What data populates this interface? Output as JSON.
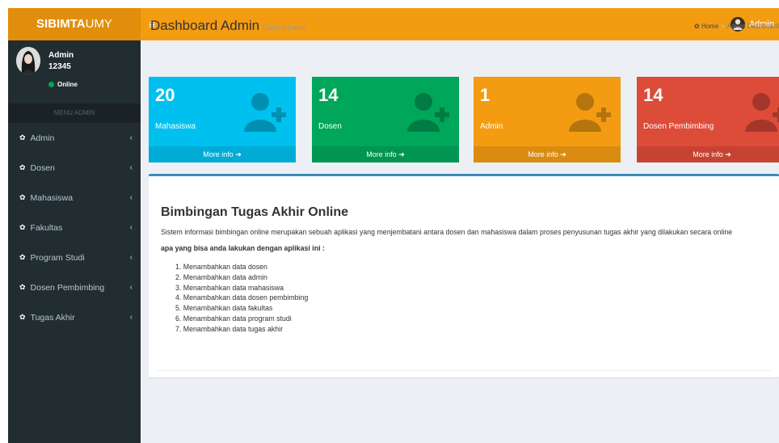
{
  "header": {
    "logo_bold": "SIBIMTA",
    "logo_light": "UMY",
    "menu_toggle": "≡",
    "user_label": "Admin"
  },
  "sidebar": {
    "user_name": "Admin",
    "user_id": "12345",
    "status": "Online",
    "menu_header": "MENU ADMIN",
    "items": [
      {
        "label": "Admin",
        "icon": "dashboard-icon"
      },
      {
        "label": "Dosen",
        "icon": "dashboard-icon"
      },
      {
        "label": "Mahasiswa",
        "icon": "dashboard-icon"
      },
      {
        "label": "Fakultas",
        "icon": "dashboard-icon"
      },
      {
        "label": "Program Studi",
        "icon": "dashboard-icon"
      },
      {
        "label": "Dosen Pembimbing",
        "icon": "dashboard-icon"
      },
      {
        "label": "Tugas Akhir",
        "icon": "dashboard-icon"
      }
    ]
  },
  "content": {
    "title": "Dashboard Admin",
    "subtitle": "Control panel",
    "breadcrumb": {
      "home": "Home",
      "separator": ">",
      "current": "Admin Dashboard"
    }
  },
  "stat_boxes": [
    {
      "value": "20",
      "label": "Mahasiswa",
      "link": "More info",
      "color": "#00c0ef"
    },
    {
      "value": "14",
      "label": "Dosen",
      "link": "More info",
      "color": "#00a65a"
    },
    {
      "value": "1",
      "label": "Admin",
      "link": "More info",
      "color": "#f39c12"
    },
    {
      "value": "14",
      "label": "Dosen Pembimbing",
      "link": "More info",
      "color": "#dd4b39"
    }
  ],
  "info": {
    "title": "Bimbingan Tugas Akhir Online",
    "description": "Sistem informasi bimbingan online merupakan sebuah aplikasi yang menjembatani antara dosen dan mahasiswa dalam proses penyusunan tugas akhir yang dilakukan secara online",
    "question": "apa yang bisa anda lakukan dengan aplikasi ini :",
    "list": [
      "1. Menambahkan data dosen",
      "2. Menambahkan data admin",
      "3. Menambahkan data mahasiswa",
      "4. Menambahkan data dosen pembimbing",
      "5. Menambahkan data fakultas",
      "6. Menambahkan data program studi",
      "7. Menambahkan data tugas akhir"
    ]
  }
}
